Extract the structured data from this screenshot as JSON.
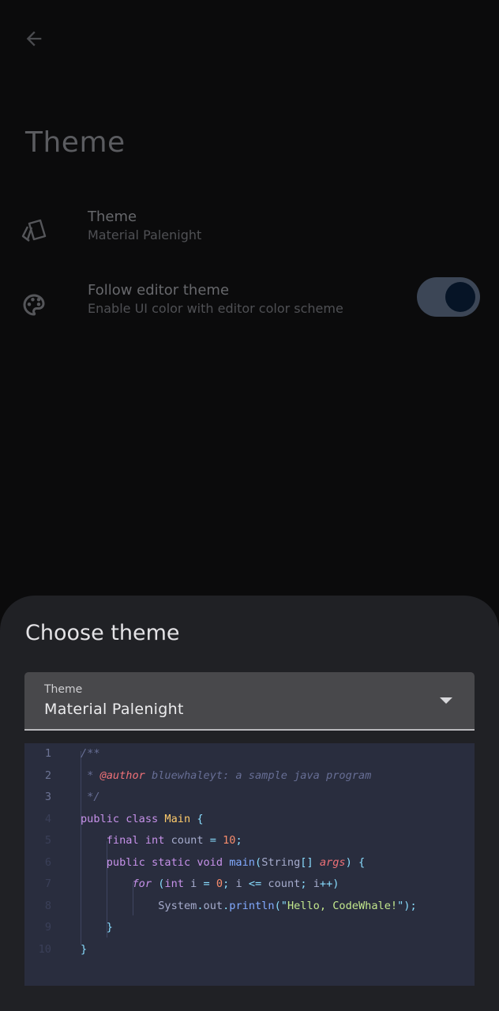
{
  "page": {
    "title": "Theme"
  },
  "preferences": [
    {
      "title": "Theme",
      "summary": "Material Palenight",
      "icon": "theme-cards-icon"
    },
    {
      "title": "Follow editor theme",
      "summary": "Enable UI color with editor color scheme",
      "icon": "palette-icon",
      "toggle_on": true
    }
  ],
  "sheet": {
    "title": "Choose theme",
    "dropdown": {
      "label": "Theme",
      "value": "Material Palenight"
    },
    "code_preview": {
      "line_numbers": [
        "1",
        "2",
        "3",
        "4",
        "5",
        "6",
        "7",
        "8",
        "9",
        "10"
      ],
      "lines": [
        [
          {
            "t": "/**",
            "c": "c-com"
          }
        ],
        [
          {
            "t": " * ",
            "c": "c-com"
          },
          {
            "t": "@author",
            "c": "c-tag"
          },
          {
            "t": " bluewhaleyt: a sample java program",
            "c": "c-com"
          }
        ],
        [
          {
            "t": " */",
            "c": "c-com"
          }
        ],
        [
          {
            "t": "public class ",
            "c": "c-kw"
          },
          {
            "t": "Main",
            "c": "c-type"
          },
          {
            "t": " {",
            "c": "c-pun"
          }
        ],
        [
          {
            "t": "    final int ",
            "c": "c-kw"
          },
          {
            "t": "count ",
            "c": "c-plain"
          },
          {
            "t": "= ",
            "c": "c-pun"
          },
          {
            "t": "10",
            "c": "c-num"
          },
          {
            "t": ";",
            "c": "c-pun"
          }
        ],
        [
          {
            "t": "    public static void ",
            "c": "c-kw"
          },
          {
            "t": "main",
            "c": "c-fn"
          },
          {
            "t": "(",
            "c": "c-pun"
          },
          {
            "t": "String",
            "c": "c-plain"
          },
          {
            "t": "[] ",
            "c": "c-pun"
          },
          {
            "t": "args",
            "c": "c-tag"
          },
          {
            "t": ") {",
            "c": "c-pun"
          }
        ],
        [
          {
            "t": "        ",
            "c": "c-plain"
          },
          {
            "t": "for",
            "c": "c-it"
          },
          {
            "t": " (",
            "c": "c-pun"
          },
          {
            "t": "int ",
            "c": "c-kw"
          },
          {
            "t": "i ",
            "c": "c-plain"
          },
          {
            "t": "= ",
            "c": "c-pun"
          },
          {
            "t": "0",
            "c": "c-num"
          },
          {
            "t": "; ",
            "c": "c-pun"
          },
          {
            "t": "i ",
            "c": "c-plain"
          },
          {
            "t": "<= ",
            "c": "c-pun"
          },
          {
            "t": "count",
            "c": "c-plain"
          },
          {
            "t": "; ",
            "c": "c-pun"
          },
          {
            "t": "i",
            "c": "c-plain"
          },
          {
            "t": "++)",
            "c": "c-pun"
          }
        ],
        [
          {
            "t": "            System",
            "c": "c-plain"
          },
          {
            "t": ".",
            "c": "c-pun"
          },
          {
            "t": "out",
            "c": "c-plain"
          },
          {
            "t": ".",
            "c": "c-pun"
          },
          {
            "t": "println",
            "c": "c-fn"
          },
          {
            "t": "(\"",
            "c": "c-pun"
          },
          {
            "t": "Hello, CodeWhale!",
            "c": "c-str"
          },
          {
            "t": "\");",
            "c": "c-pun"
          }
        ],
        [
          {
            "t": "    }",
            "c": "c-pun"
          }
        ],
        [
          {
            "t": "}",
            "c": "c-pun"
          }
        ]
      ]
    }
  },
  "colors": {
    "sheet_bg": "#202125",
    "code_bg": "#292d3e",
    "toggle_track": "#3c4656",
    "toggle_knob": "#061426"
  }
}
